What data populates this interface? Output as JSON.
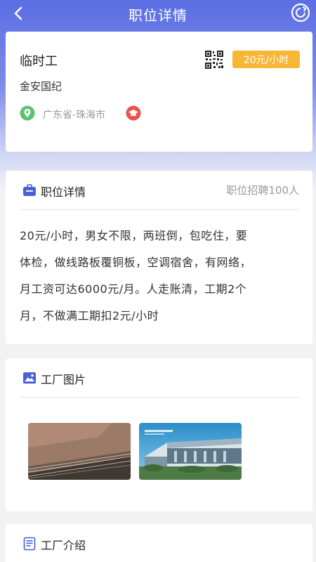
{
  "header": {
    "title": "职位详情",
    "back_icon": "chevron-left-icon",
    "refresh_icon": "refresh-icon"
  },
  "job": {
    "title": "临时工",
    "company": "金安国纪",
    "salary": "20元/小时",
    "location": "广东省-珠海市",
    "qr_icon": "qr-code-icon",
    "location_icon": "location-pin-icon",
    "education_icon": "graduation-cap-icon"
  },
  "detail": {
    "title": "职位详情",
    "headcount": "职位招聘100人",
    "lines": [
      "20元/小时，男女不限，两班倒，包吃住，要",
      "体检，做线路板覆铜板，空调宿舍，有网络，",
      "月工资可达6000元/月。人走账清，工期2个",
      "月，不做满工期扣2元/小时"
    ]
  },
  "photos": {
    "title": "工厂图片",
    "items": [
      "copper-clad-laminate-photo",
      "factory-building-photo"
    ]
  },
  "intro": {
    "title": "工厂介绍"
  },
  "colors": {
    "header_gradient_top": "#5b6ee3",
    "salary_badge": "#f7b634",
    "accent": "#4a5fd8",
    "location_icon": "#5cc36f",
    "education_icon": "#e9534a"
  }
}
